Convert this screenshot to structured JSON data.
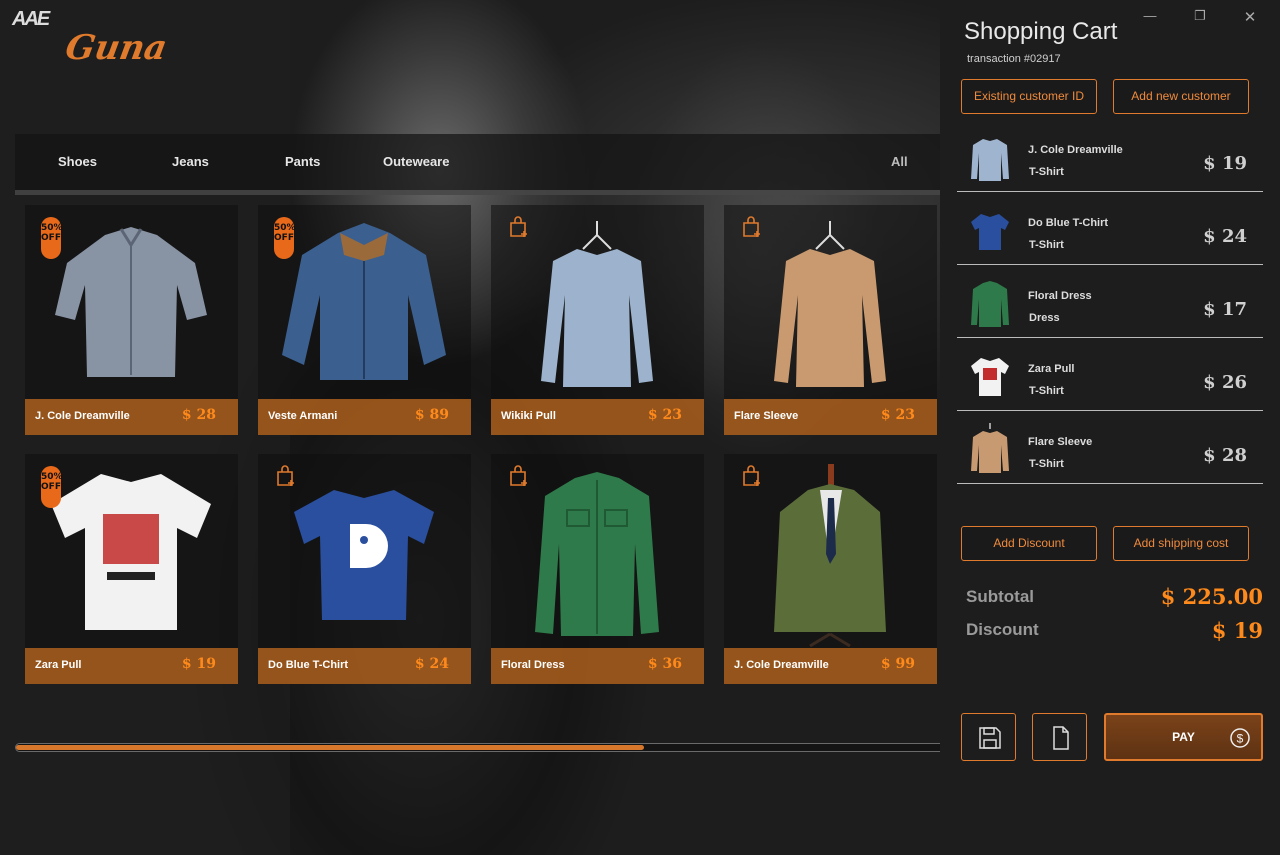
{
  "brand": {
    "mark": "AAE",
    "logo": "Guna"
  },
  "categories": [
    "Shoes",
    "Jeans",
    "Pants",
    "Outeweare"
  ],
  "category_all": "All",
  "products": [
    {
      "name": "J. Cole Dreamville",
      "price": "$ 28",
      "badge": "50% OFF",
      "icon": "checked-shirt"
    },
    {
      "name": "Veste Armani",
      "price": "$ 89",
      "badge": "50% OFF",
      "icon": "denim-jacket"
    },
    {
      "name": "Wikiki Pull",
      "price": "$ 23",
      "badge": "",
      "icon": "light-blue-sweater"
    },
    {
      "name": "Flare Sleeve",
      "price": "$ 23",
      "badge": "",
      "icon": "tan-sweater"
    },
    {
      "name": "Zara Pull",
      "price": "$ 19",
      "badge": "50% OFF",
      "icon": "white-graphic-tee"
    },
    {
      "name": "Do Blue T-Chirt",
      "price": "$ 24",
      "badge": "",
      "icon": "blue-tee"
    },
    {
      "name": "Floral Dress",
      "price": "$ 36",
      "badge": "",
      "icon": "green-shirt"
    },
    {
      "name": "J. Cole Dreamville",
      "price": "$ 99",
      "badge": "",
      "icon": "green-blazer"
    }
  ],
  "scroll": {
    "position_fraction": 0.67
  },
  "cart": {
    "title": "Shopping Cart",
    "transaction": "transaction #02917",
    "existing_customer": "Existing customer ID",
    "add_customer": "Add new customer",
    "items": [
      {
        "name": "J. Cole Dreamville",
        "type": "T-Shirt",
        "price": "$ 19",
        "color": "#9fb4cf"
      },
      {
        "name": "Do Blue T-Chirt",
        "type": "T-Shirt",
        "price": "$ 24",
        "color": "#2a4f9e"
      },
      {
        "name": "Floral Dress",
        "type": "Dress",
        "price": "$ 17",
        "color": "#2f7a4a"
      },
      {
        "name": "Zara Pull",
        "type": "T-Shirt",
        "price": "$ 26",
        "color": "#f2f2f2"
      },
      {
        "name": "Flare Sleeve",
        "type": "T-Shirt",
        "price": "$ 28",
        "color": "#c89a72"
      }
    ],
    "add_discount": "Add Discount",
    "add_shipping": "Add shipping cost",
    "subtotal_label": "Subtotal",
    "subtotal_value": "$ 225.00",
    "discount_label": "Discount",
    "discount_value": "$ 19",
    "pay_label": "PAY"
  },
  "colors": {
    "accent": "#e07a2c",
    "price": "#ff8a1c"
  }
}
